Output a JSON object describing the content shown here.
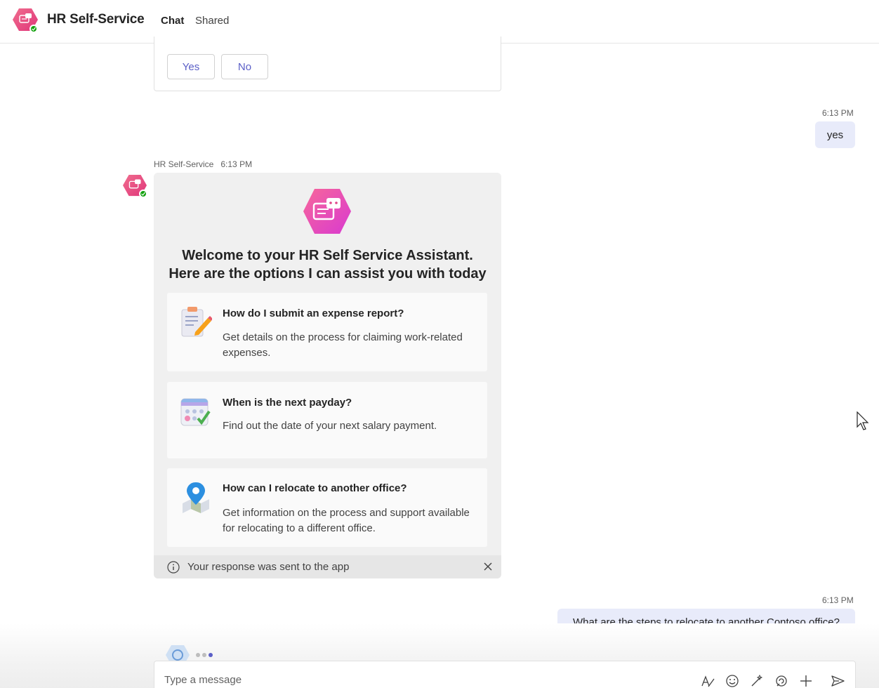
{
  "header": {
    "title": "HR Self-Service",
    "tabs": [
      {
        "label": "Chat",
        "active": true
      },
      {
        "label": "Shared",
        "active": false
      }
    ],
    "presence": "available"
  },
  "previous_card": {
    "yes_label": "Yes",
    "no_label": "No"
  },
  "messages": [
    {
      "from": "user",
      "time": "6:13 PM",
      "text": "yes"
    },
    {
      "from": "bot",
      "sender": "HR Self-Service",
      "time": "6:13 PM",
      "card": {
        "title": "Welcome to your HR Self Service Assistant. Here are the options I can assist you with today",
        "options": [
          {
            "icon": "expense-report-icon",
            "title": "How do I submit an expense report?",
            "description": "Get details on the process for claiming work-related expenses."
          },
          {
            "icon": "calendar-payday-icon",
            "title": "When is the next payday?",
            "description": "Find out the date of your next salary payment."
          },
          {
            "icon": "map-pin-icon",
            "title": "How can I relocate to another office?",
            "description": "Get information on the process and support available for relocating to a different office."
          }
        ],
        "notice": "Your response was sent to the app"
      }
    },
    {
      "from": "user",
      "time": "6:13 PM",
      "text": "What are the steps to relocate to another Contoso office?"
    }
  ],
  "composer": {
    "placeholder": "Type a message"
  },
  "colors": {
    "accent": "#5b5fc7",
    "bot_pink": "#e8467c",
    "user_bubble": "#e8ebfa",
    "presence_green": "#13a10e"
  }
}
